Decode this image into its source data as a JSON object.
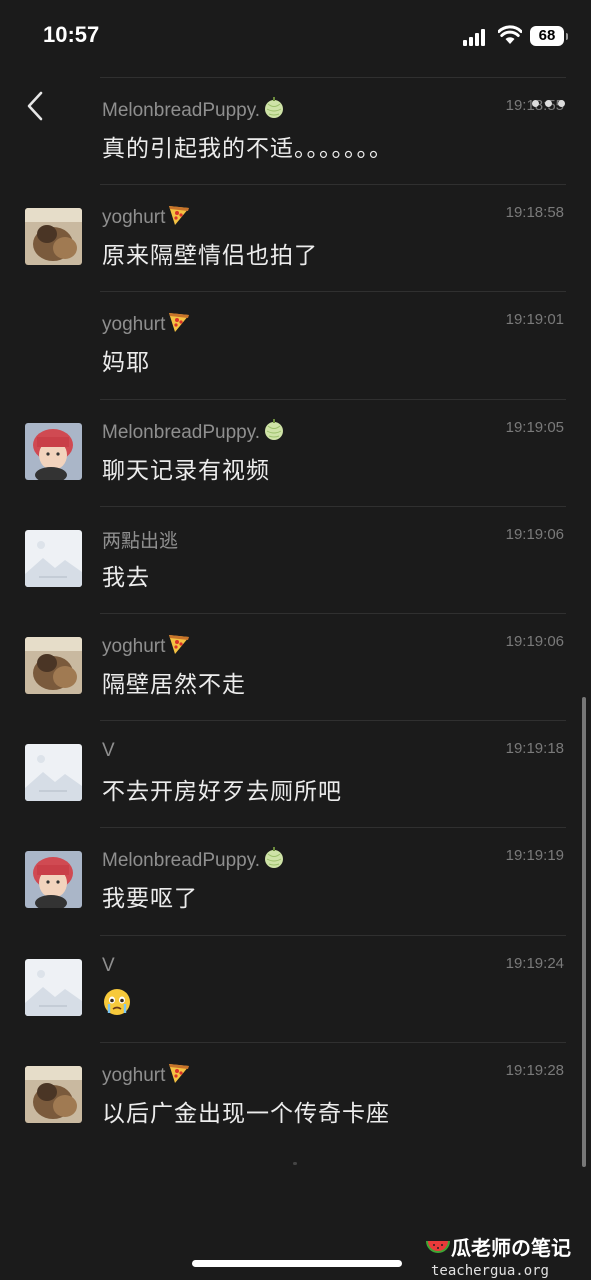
{
  "status_bar": {
    "time": "10:57",
    "battery": "68"
  },
  "messages": [
    {
      "name": "MelonbreadPuppy.",
      "badge": "melon",
      "time": "19:18:55",
      "text": "真的引起我的不适。。。。。。。",
      "avatar": "none"
    },
    {
      "name": "yoghurt",
      "badge": "pizza",
      "time": "19:18:58",
      "text": "原来隔壁情侣也拍了",
      "avatar": "dog"
    },
    {
      "name": "yoghurt",
      "badge": "pizza",
      "time": "19:19:01",
      "text": "妈耶",
      "avatar": "none"
    },
    {
      "name": "MelonbreadPuppy.",
      "badge": "melon",
      "time": "19:19:05",
      "text": "聊天记录有视频",
      "avatar": "boy"
    },
    {
      "name": "两點出逃",
      "badge": "",
      "time": "19:19:06",
      "text": "我去",
      "avatar": "placeholder"
    },
    {
      "name": "yoghurt",
      "badge": "pizza",
      "time": "19:19:06",
      "text": "隔壁居然不走",
      "avatar": "dog"
    },
    {
      "name": "V",
      "badge": "",
      "time": "19:19:18",
      "text": "不去开房好歹去厕所吧",
      "avatar": "placeholder"
    },
    {
      "name": "MelonbreadPuppy.",
      "badge": "melon",
      "time": "19:19:19",
      "text": "我要呕了",
      "avatar": "boy"
    },
    {
      "name": "V",
      "badge": "",
      "time": "19:19:24",
      "text": "",
      "emoji": "crying-face",
      "avatar": "placeholder"
    },
    {
      "name": "yoghurt",
      "badge": "pizza",
      "time": "19:19:28",
      "text": "以后广金出现一个传奇卡座",
      "avatar": "dog"
    }
  ],
  "watermark": {
    "title": "瓜老师の笔记",
    "url": "teachergua.org"
  },
  "colors": {
    "background": "#1b1b1b",
    "name": "#8f8f8f",
    "text": "#ececec",
    "timestamp": "#7a7a7a"
  }
}
